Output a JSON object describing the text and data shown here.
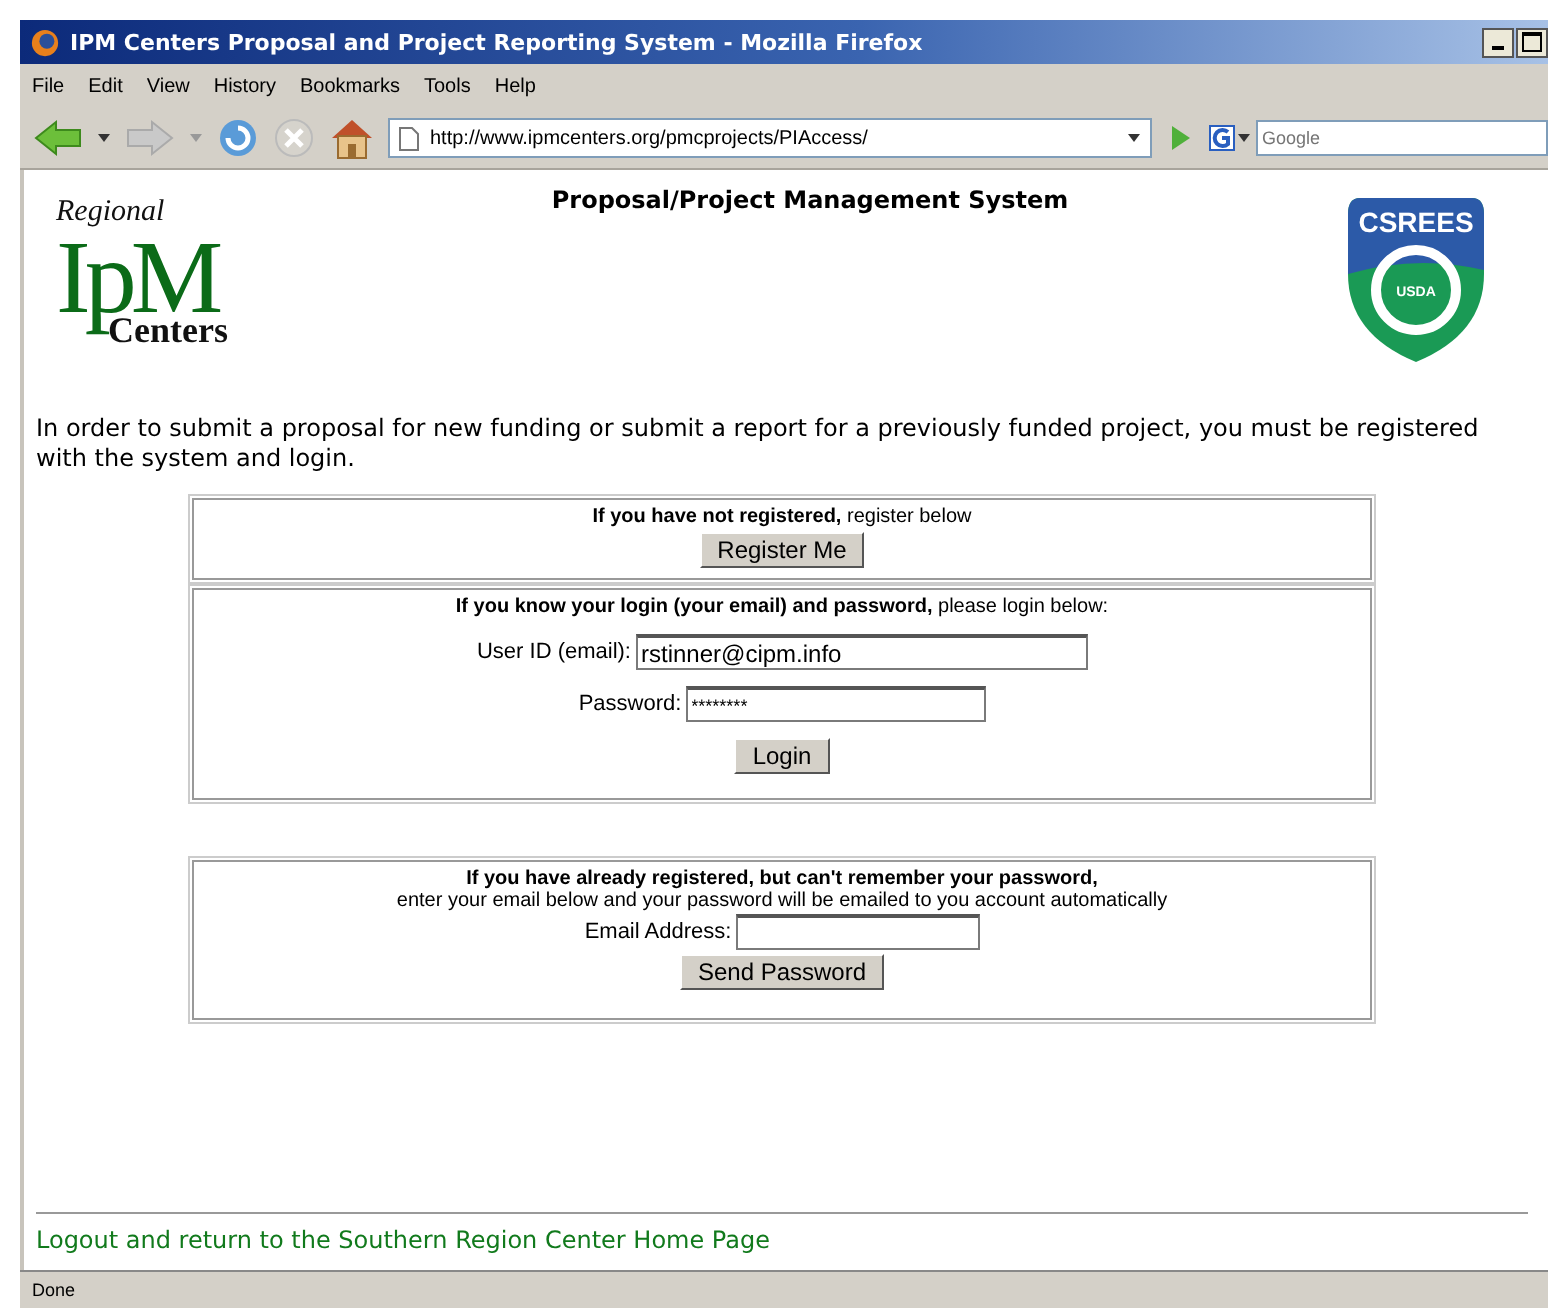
{
  "window": {
    "title": "IPM Centers Proposal and Project Reporting System - Mozilla Firefox"
  },
  "menu": [
    "File",
    "Edit",
    "View",
    "History",
    "Bookmarks",
    "Tools",
    "Help"
  ],
  "address": {
    "value": "http://www.ipmcenters.org/pmcprojects/PIAccess/"
  },
  "search": {
    "placeholder": "Google"
  },
  "page": {
    "heading": "Proposal/Project Management System",
    "logo": {
      "top": "Regional",
      "main": "IpM",
      "bottom": "Centers"
    },
    "seal": {
      "top": "CSREES",
      "center": "USDA"
    },
    "intro": "In order to submit a proposal for new funding or submit a report for a previously funded project, you must be registered with the system and login.",
    "register": {
      "text": "**If you have not registered,** register below",
      "button": "Register Me"
    },
    "login": {
      "text": "**If you know your login (your email) and password,** please login below:",
      "fields": [
        {
          "label": "User ID (email):",
          "value": "rstinner@cipm.info",
          "kind": "text"
        },
        {
          "label": "Password:",
          "value": "********",
          "kind": "password"
        }
      ],
      "button": "Login"
    },
    "forgot": {
      "title": "If you have already registered, but can't remember your password,",
      "text": "enter your email below and your password will be emailed to you account automatically",
      "label": "Email Address:",
      "button": "Send Password"
    },
    "footer_link": "Logout and return to the Southern Region Center Home Page"
  },
  "status_bar": "Done"
}
